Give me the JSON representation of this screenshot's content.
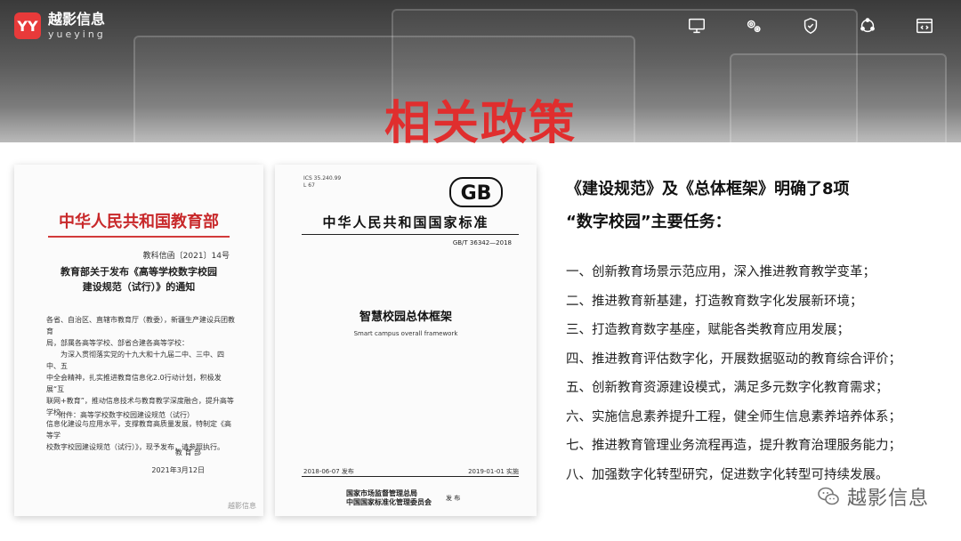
{
  "header": {
    "brand_cn": "越影信息",
    "brand_en": "yueying",
    "logo_mark": "YY",
    "icons": [
      "monitor-icon",
      "gears-icon",
      "shield-icon",
      "refresh-icon",
      "code-window-icon"
    ]
  },
  "title": "相关政策",
  "doc_left": {
    "title": "中华人民共和国教育部",
    "number": "教科信函〔2021〕14号",
    "heading_line1": "教育部关于发布《高等学校数字校园",
    "heading_line2": "建设规范（试行）》的通知",
    "para_line1": "各省、自治区、直辖市教育厅（教委），新疆生产建设兵团教育",
    "para_line2": "局，部属各高等学校、部省合建各高等学校：",
    "para_line3": "为深入贯彻落实党的十九大和十九届二中、三中、四中、五",
    "para_line4": "中全会精神，扎实推进教育信息化2.0行动计划，积极发展“互",
    "para_line5": "联网+教育”，推动信息技术与教育教学深度融合，提升高等学校",
    "para_line6": "信息化建设与应用水平，支撑教育高质量发展，特制定《高等学",
    "para_line7": "校数字校园建设规范（试行）》，现予发布，请参照执行。",
    "attachment": "附件：高等学校数字校园建设规范（试行）",
    "sign": "教 育 部",
    "date": "2021年3月12日",
    "watermark": "越影信息"
  },
  "doc_right": {
    "meta_line1": "ICS 35.240.99",
    "meta_line2": "L 67",
    "gb": "GB",
    "header": "中华人民共和国国家标准",
    "code": "GB/T 36342—2018",
    "name": "智慧校园总体框架",
    "en_name": "Smart campus overall framework",
    "release": "2018-06-07 发布",
    "implement": "2019-01-01 实施",
    "publisher_line1": "国家市场监督管理总局",
    "publisher_line2": "中国国家标准化管理委员会",
    "publisher_tag": "发 布"
  },
  "right": {
    "title_line1": "《建设规范》及《总体框架》明确了8项",
    "title_line2": "“数字校园”主要任务：",
    "items": [
      "一、创新教育场景示范应用，深入推进教育教学变革；",
      "二、推进教育新基建，打造教育数字化发展新环境；",
      "三、打造教育数字基座，赋能各类教育应用发展；",
      "四、推进教育评估数字化，开展数据驱动的教育综合评价；",
      "五、创新教育资源建设模式，满足多元数字化教育需求；",
      "六、实施信息素养提升工程，健全师生信息素养培养体系；",
      "七、推进教育管理业务流程再造，提升教育治理服务能力；",
      "八、加强数字化转型研究，促进数字化转型可持续发展。"
    ]
  },
  "watermark": {
    "text": "越影信息",
    "icon": "wechat-icon"
  },
  "colors": {
    "accent_red": "#e02e2e"
  }
}
